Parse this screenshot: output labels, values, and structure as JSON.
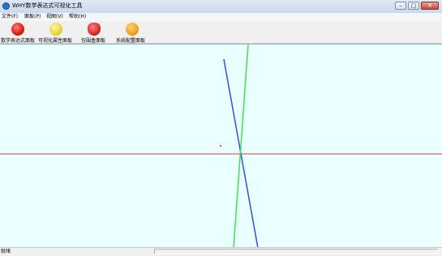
{
  "window": {
    "title": "WHY数学表达式可视化工具",
    "minimize": "–",
    "maximize": "□",
    "close": "✕"
  },
  "menu": [
    "文件(F)",
    "面板(P)",
    "视图(V)",
    "帮助(H)"
  ],
  "toolbar": [
    {
      "label": "数学表达式面板",
      "icon": "apple-icon",
      "color": "#d61f14"
    },
    {
      "label": "可视化属性面板",
      "icon": "pear-icon",
      "color": "#e7d43a"
    },
    {
      "label": "包围盒面板",
      "icon": "strawberry-icon",
      "color": "#d82a2a"
    },
    {
      "label": "系统配置面板",
      "icon": "orange-icon",
      "color": "#f2a41a"
    }
  ],
  "canvas": {
    "background": "#eaffff",
    "axis_color": "#e03a3a",
    "line_blue": "#3a4ae0",
    "line_green": "#44e04a"
  },
  "status": {
    "text": "就绪"
  }
}
